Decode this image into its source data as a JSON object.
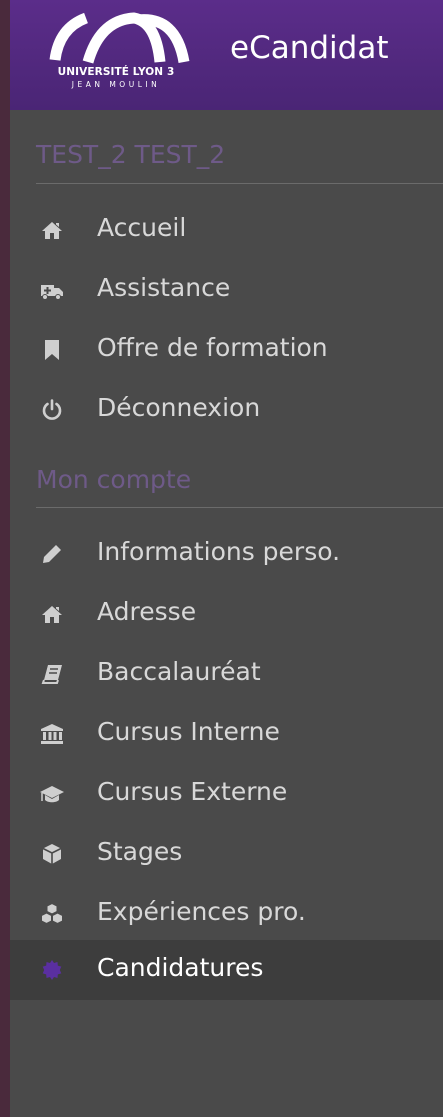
{
  "header": {
    "app_title": "eCandidat",
    "logo": {
      "line1": "UNIVERSITÉ LYON 3",
      "line2": "JEAN MOULIN"
    }
  },
  "user_section": {
    "title": "TEST_2 TEST_2",
    "items": [
      {
        "label": "Accueil",
        "icon": "home-icon"
      },
      {
        "label": "Assistance",
        "icon": "ambulance-icon"
      },
      {
        "label": "Offre de formation",
        "icon": "bookmark-icon"
      },
      {
        "label": "Déconnexion",
        "icon": "power-icon"
      }
    ]
  },
  "account_section": {
    "title": "Mon compte",
    "items": [
      {
        "label": "Informations perso.",
        "icon": "pencil-icon"
      },
      {
        "label": "Adresse",
        "icon": "home-icon"
      },
      {
        "label": "Baccalauréat",
        "icon": "book-icon"
      },
      {
        "label": "Cursus Interne",
        "icon": "institution-icon"
      },
      {
        "label": "Cursus Externe",
        "icon": "graduation-cap-icon"
      },
      {
        "label": "Stages",
        "icon": "cube-icon"
      },
      {
        "label": "Expériences pro.",
        "icon": "cubes-icon"
      },
      {
        "label": "Candidatures",
        "icon": "certificate-icon",
        "active": true
      }
    ]
  },
  "colors": {
    "header_bg": "#5b2d8a",
    "sidebar_bg": "#4a4a4a",
    "active_bg": "#3d3d3d",
    "section_title": "#6e5a88",
    "menu_text": "#d8d8d8",
    "icon": "#cfcfcf",
    "active_icon": "#5a2fa0"
  }
}
